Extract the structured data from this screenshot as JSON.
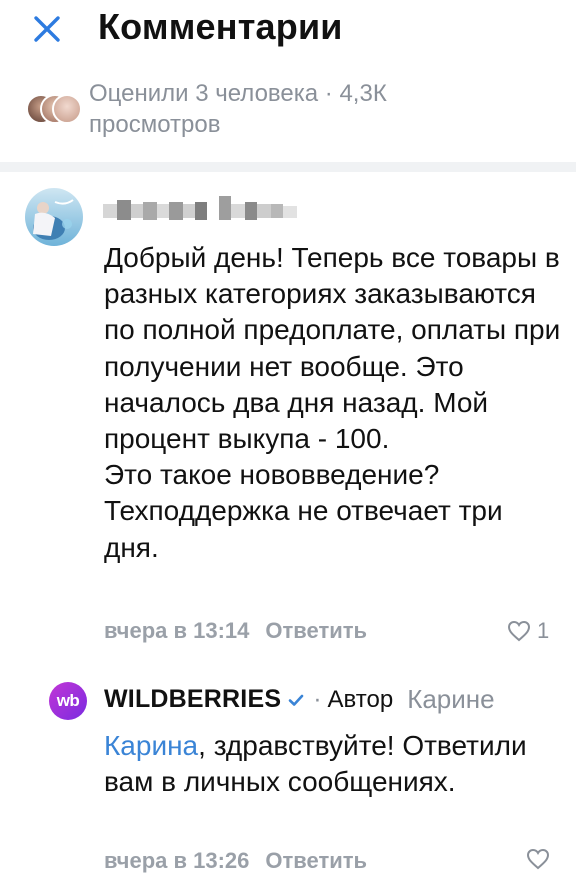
{
  "header": {
    "title": "Комментарии",
    "close_icon": "close-icon",
    "accent": "#2d7be0"
  },
  "likes_summary": {
    "text": "Оценили 3 человека · 4,3К просмотров"
  },
  "comments": [
    {
      "author_name": "",
      "author_name_blurred": true,
      "text": "Добрый день! Теперь все товары в разных категориях заказываются по полной предоплате, оплаты при получении нет вообще. Это началось два дня назад. Мой процент  выкупа - 100.\nЭто такое нововведение? Техподдержка не отвечает три дня.",
      "time": "вчера в 13:14",
      "reply_label": "Ответить",
      "like_icon": "heart-icon",
      "like_count": "1"
    }
  ],
  "reply": {
    "avatar_text": "wb",
    "author": "WILDBERRIES",
    "verified_icon": "verified-check-icon",
    "separator": "·",
    "author_badge": "Автор",
    "reply_to": "Карине",
    "mention": "Карина",
    "text": ", здравствуйте! Ответили вам в личных сообщениях.",
    "time": "вчера в 13:26",
    "reply_label": "Ответить",
    "like_icon": "heart-icon"
  }
}
